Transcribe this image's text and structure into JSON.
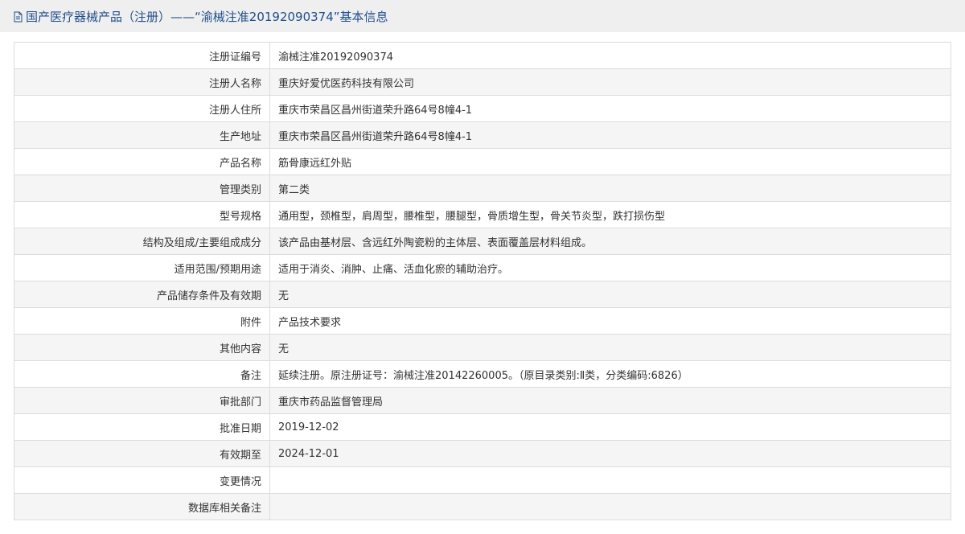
{
  "header": {
    "icon": "document-icon",
    "title": "国产医疗器械产品（注册）——“渝械注准20192090374”基本信息",
    "accent_color": "#1e4e8c"
  },
  "rows": [
    {
      "label": "注册证编号",
      "value": "渝械注准20192090374"
    },
    {
      "label": "注册人名称",
      "value": "重庆好爱优医药科技有限公司"
    },
    {
      "label": "注册人住所",
      "value": "重庆市荣昌区昌州街道荣升路64号8幢4-1"
    },
    {
      "label": "生产地址",
      "value": "重庆市荣昌区昌州街道荣升路64号8幢4-1"
    },
    {
      "label": "产品名称",
      "value": "筋骨康远红外贴"
    },
    {
      "label": "管理类别",
      "value": "第二类"
    },
    {
      "label": "型号规格",
      "value": "通用型，颈椎型，肩周型，腰椎型，腰腿型，骨质增生型，骨关节炎型，跌打损伤型"
    },
    {
      "label": "结构及组成/主要组成成分",
      "value": "该产品由基材层、含远红外陶瓷粉的主体层、表面覆盖层材料组成。"
    },
    {
      "label": "适用范围/预期用途",
      "value": "适用于消炎、消肿、止痛、活血化瘀的辅助治疗。"
    },
    {
      "label": "产品储存条件及有效期",
      "value": "无"
    },
    {
      "label": "附件",
      "value": "产品技术要求"
    },
    {
      "label": "其他内容",
      "value": "无"
    },
    {
      "label": "备注",
      "value": "延续注册。原注册证号：渝械注准20142260005。（原目录类别:Ⅱ类，分类编码:6826）"
    },
    {
      "label": "审批部门",
      "value": "重庆市药品监督管理局"
    },
    {
      "label": "批准日期",
      "value": "2019-12-02"
    },
    {
      "label": "有效期至",
      "value": "2024-12-01"
    },
    {
      "label": "变更情况",
      "value": ""
    },
    {
      "label": "数据库相关备注",
      "value": ""
    }
  ]
}
